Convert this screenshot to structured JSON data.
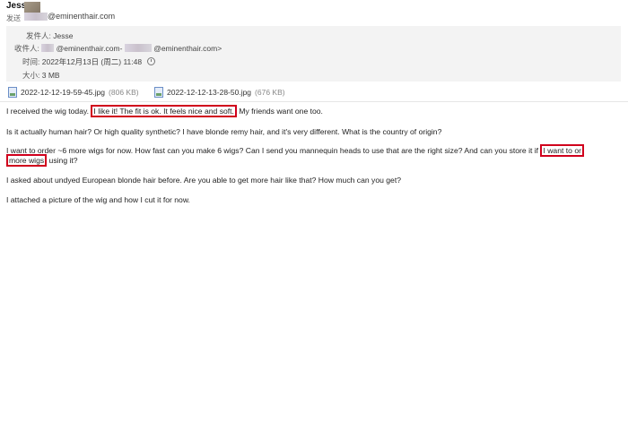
{
  "header": {
    "sender_name": "Jesse",
    "to_label": "发送",
    "to_address_visible": "@eminenthair.com"
  },
  "info": {
    "from_label": "发件人:",
    "from_value": "Jesse",
    "recipient_label": "收件人:",
    "recipient_part1": "@eminenthair.com-",
    "recipient_part2": "@eminenthair.com>",
    "time_label": "时间:",
    "time_value": "2022年12月13日 (周二) 11:48",
    "size_label": "大小:",
    "size_value": "3 MB"
  },
  "attachments": [
    {
      "name": "2022-12-12-19-59-45.jpg",
      "size": "(806 KB)"
    },
    {
      "name": "2022-12-12-13-28-50.jpg",
      "size": "(676 KB)"
    }
  ],
  "message": {
    "p1_before": "I received the wig today. ",
    "p1_highlight": "I like it! The fit is ok. It feels nice and soft.",
    "p1_after": " My friends want one too.",
    "p2": "Is it actually human hair? Or high quality synthetic? I have blonde remy hair, and it's very different. What is the country of origin?",
    "p3_before": "I want to order ~6 more wigs for now. How fast can you make 6 wigs? Can I send you mannequin heads to use that are the right size? And can you store it if ",
    "p3_highlight_a": "I want to or",
    "p3_highlight_b": "more wigs",
    "p3_after": " using it?",
    "p4": "I asked about undyed European blonde hair before. Are you able to get more hair like that? How much can you get?",
    "p5": "I attached a picture of the wig and how I cut it for now."
  }
}
